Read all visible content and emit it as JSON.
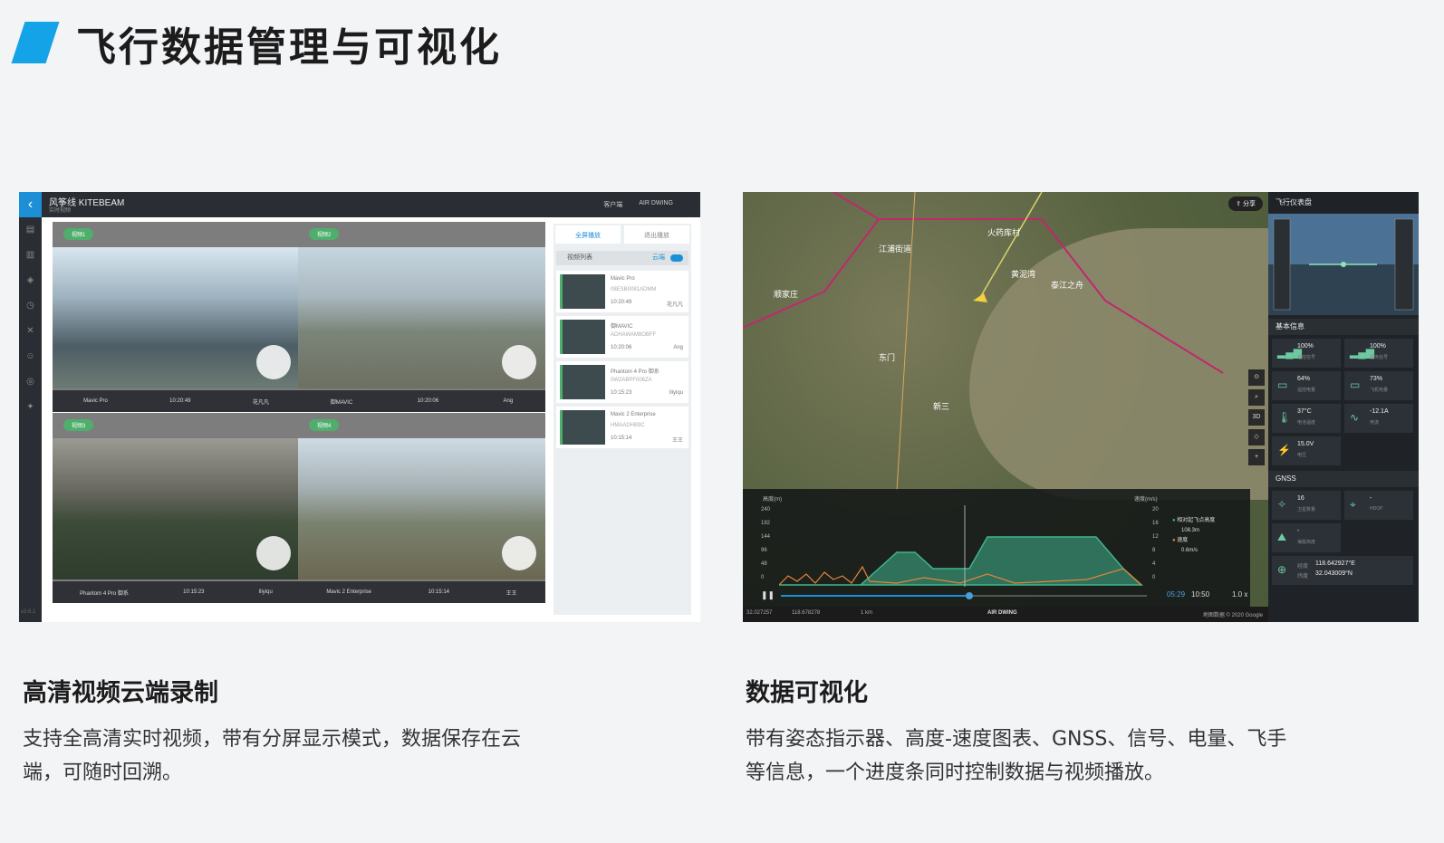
{
  "header": {
    "title": "飞行数据管理与可视化"
  },
  "left_card": {
    "title": "高清视频云端录制",
    "desc_line1": "支持全高清实时视频，带有分屏显示模式，数据保存在云",
    "desc_line2": "端，可随时回溯。",
    "app": {
      "brand": "风筝线 KITEBEAM",
      "subtitle": "实时视频",
      "topbar": [
        "客户端",
        "AIR DWING"
      ],
      "tiles": [
        {
          "badge": "视频1",
          "model": "Mavic Pro",
          "time": "10:20:49",
          "user": "花凡凡"
        },
        {
          "badge": "视频2",
          "model": "御MAVIC",
          "time": "10:20:06",
          "user": "Ang"
        },
        {
          "badge": "视频3",
          "model": "Phantom 4 Pro 御系",
          "time": "10:15:23",
          "user": "lliyiqu"
        },
        {
          "badge": "视频4",
          "model": "Mavic 2 Enterprise",
          "time": "10:15:14",
          "user": "王王"
        }
      ],
      "panel_tabs": [
        "全屏播放",
        "退出播放"
      ],
      "list_title": "视频列表",
      "list_toggle": "云端",
      "list_items": [
        {
          "name": "Mavic Pro",
          "sn": "08ESB0081ADMM",
          "time": "10:20:49",
          "user": "花凡凡"
        },
        {
          "name": "御MAVIC",
          "sn": "ADHAWAM8OBFF",
          "time": "10:20:06",
          "user": "Ang"
        },
        {
          "name": "Phantom 4 Pro 御系",
          "sn": "0W2ABPF006ZA",
          "time": "10:15:23",
          "user": "lliyiqu"
        },
        {
          "name": "Mavic 2 Enterprise",
          "sn": "HMAADHB9C",
          "time": "10:15:14",
          "user": "王王"
        }
      ],
      "version": "v3.6.1"
    }
  },
  "right_card": {
    "title": "数据可视化",
    "desc_line1": "带有姿态指示器、高度-速度图表、GNSS、信号、电量、飞手",
    "desc_line2": "等信息，一个进度条同时控制数据与视频播放。",
    "app": {
      "share": "分享",
      "map_labels": [
        "火药库村",
        "江浦街道",
        "黄泥湾",
        "顺家庄",
        "泰江之舟",
        "东门",
        "新三"
      ],
      "chart_left_axis": "高度(m)",
      "chart_right_axis": "速度(m/s)",
      "chart_left_ticks": [
        "240",
        "192",
        "144",
        "96",
        "48",
        "0"
      ],
      "chart_right_ticks": [
        "20",
        "16",
        "12",
        "8",
        "4",
        "0"
      ],
      "legend": [
        {
          "label": "相对起飞点高度",
          "value": "108.3m",
          "color": "#3fb58e"
        },
        {
          "label": "速度",
          "value": "0.6m/s",
          "color": "#e8843a"
        }
      ],
      "time_current": "05:29",
      "time_total": "10:50",
      "speed": "1.0 x",
      "coords": [
        "32.027257",
        "118.678278"
      ],
      "scale": "1 km",
      "brand": "AIR DWING",
      "map_attrib": "地图数据 © 2020 Google",
      "dashboard_title": "飞行仪表盘",
      "basic_info": "基本信息",
      "gnss": "GNSS",
      "cells": [
        {
          "icon": "signal-icon",
          "value": "100%",
          "key": "遥控信号"
        },
        {
          "icon": "signal-icon",
          "value": "100%",
          "key": "图传信号"
        },
        {
          "icon": "battery-icon",
          "value": "64%",
          "key": "遥控电量"
        },
        {
          "icon": "battery-icon",
          "value": "73%",
          "key": "飞机电量"
        },
        {
          "icon": "thermometer-icon",
          "value": "37°C",
          "key": "电池温度"
        },
        {
          "icon": "current-icon",
          "value": "-12.1A",
          "key": "电流"
        },
        {
          "icon": "voltage-icon",
          "value": "15.0V",
          "key": "电压"
        }
      ],
      "gnss_cells": [
        {
          "icon": "satellite-icon",
          "value": "16",
          "key": "卫星数量"
        },
        {
          "icon": "location-icon",
          "value": "-",
          "key": "HDOP"
        },
        {
          "icon": "altitude-icon",
          "value": "-",
          "key": "海拔高度"
        }
      ],
      "position": {
        "lng_label": "经度",
        "lng": "118.642927°E",
        "lat_label": "纬度",
        "lat": "32.043009°N"
      }
    }
  },
  "colors": {
    "accent": "#14a3e6",
    "altitude": "#3fb58e",
    "speed": "#e8843a"
  }
}
